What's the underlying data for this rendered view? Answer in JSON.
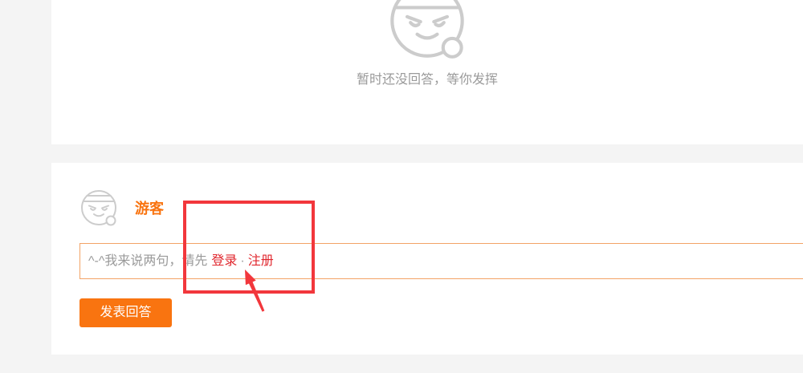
{
  "colors": {
    "page_background": "#f4f4f4",
    "card_background": "#ffffff",
    "accent": "#f97410",
    "input_border": "#f3a366",
    "link": "#e0262d",
    "muted_text": "#9a9a9a",
    "icon_stroke": "#cccccc",
    "annotation": "#f2373c"
  },
  "answers": {
    "empty_icon": "mascot-face-icon",
    "empty_message": "暂时还没回答，等你发挥"
  },
  "composer": {
    "avatar_icon": "mascot-face-icon",
    "username": "游客",
    "input": {
      "prompt": "^-^我来说两句，请先",
      "login_label": "登录",
      "separator": "·",
      "register_label": "注册"
    },
    "submit_label": "发表回答"
  }
}
